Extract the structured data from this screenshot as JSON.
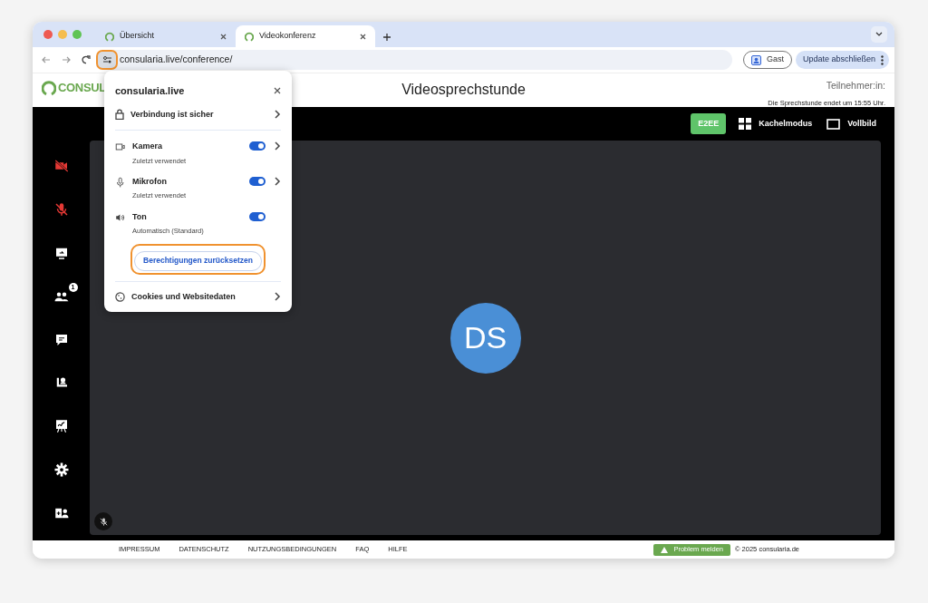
{
  "browser": {
    "tabs": [
      {
        "label": "Übersicht",
        "selected": false
      },
      {
        "label": "Videokonferenz",
        "selected": true
      }
    ],
    "url": "consularia.live/conference/",
    "profile": "Gast",
    "update_button": "Update abschließen"
  },
  "header": {
    "logo": "CONSUL",
    "title": "Videosprechstunde",
    "participants_label": "Teilnehmer:in:",
    "end_notice": "Die Sprechstunde endet um 15:55 Uhr."
  },
  "toolbar": {
    "e2ee": "E2EE",
    "tile_mode": "Kachelmodus",
    "fullscreen": "Vollbild"
  },
  "sidebar": [
    {
      "kind": "camera",
      "off": true
    },
    {
      "kind": "mic",
      "off": true
    },
    {
      "kind": "screen",
      "off": false
    },
    {
      "kind": "participants",
      "off": false,
      "badge": "1"
    },
    {
      "kind": "chat",
      "off": false
    },
    {
      "kind": "waiting",
      "off": false
    },
    {
      "kind": "whiteboard",
      "off": false
    },
    {
      "kind": "settings",
      "off": false
    },
    {
      "kind": "invite",
      "off": false
    }
  ],
  "video": {
    "initials": "DS"
  },
  "site_info": {
    "title": "consularia.live",
    "connection": "Verbindung ist sicher",
    "permissions": [
      {
        "kind": "camera",
        "label": "Kamera",
        "detail": "Zuletzt verwendet",
        "on": true,
        "arrow": true
      },
      {
        "kind": "mic",
        "label": "Mikrofon",
        "detail": "Zuletzt verwendet",
        "on": true,
        "arrow": true
      },
      {
        "kind": "sound",
        "label": "Ton",
        "detail": "Automatisch (Standard)",
        "on": true,
        "arrow": false
      }
    ],
    "reset_button": "Berechtigungen zurücksetzen",
    "cookies": "Cookies und Websitedaten"
  },
  "footer": {
    "links": [
      "IMPRESSUM",
      "DATENSCHUTZ",
      "NUTZUNGSBEDINGUNGEN",
      "FAQ",
      "HILFE"
    ],
    "problem_button": "Problem melden",
    "copyright": "© 2025 consularia.de"
  }
}
